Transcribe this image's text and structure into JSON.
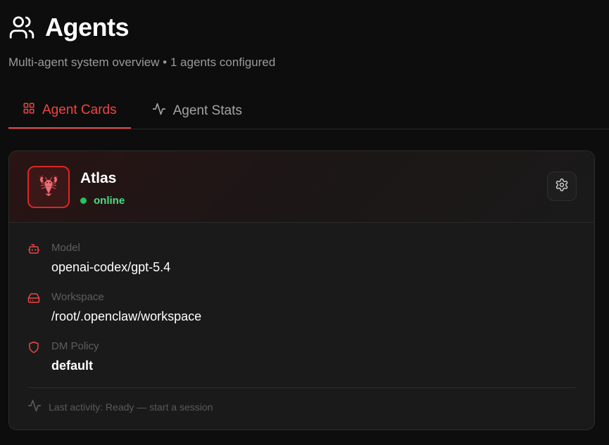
{
  "header": {
    "title": "Agents",
    "subtitle": "Multi-agent system overview • 1 agents configured",
    "icon": "users-icon"
  },
  "tabs": [
    {
      "label": "Agent Cards",
      "icon": "grid-icon",
      "active": true
    },
    {
      "label": "Agent Stats",
      "icon": "activity-icon",
      "active": false
    }
  ],
  "agent": {
    "name": "Atlas",
    "status": "online",
    "avatar_icon": "lobster-icon",
    "fields": {
      "model": {
        "label": "Model",
        "value": "openai-codex/gpt-5.4",
        "icon": "bot-icon"
      },
      "workspace": {
        "label": "Workspace",
        "value": "/root/.openclaw/workspace",
        "icon": "hard-drive-icon"
      },
      "dm_policy": {
        "label": "DM Policy",
        "value": "default",
        "icon": "shield-icon"
      }
    },
    "last_activity": "Last activity: Ready — start a session"
  },
  "colors": {
    "accent": "#ef4444",
    "online": "#22c55e",
    "background": "#0d0d0d",
    "card": "#1a1a1a"
  }
}
